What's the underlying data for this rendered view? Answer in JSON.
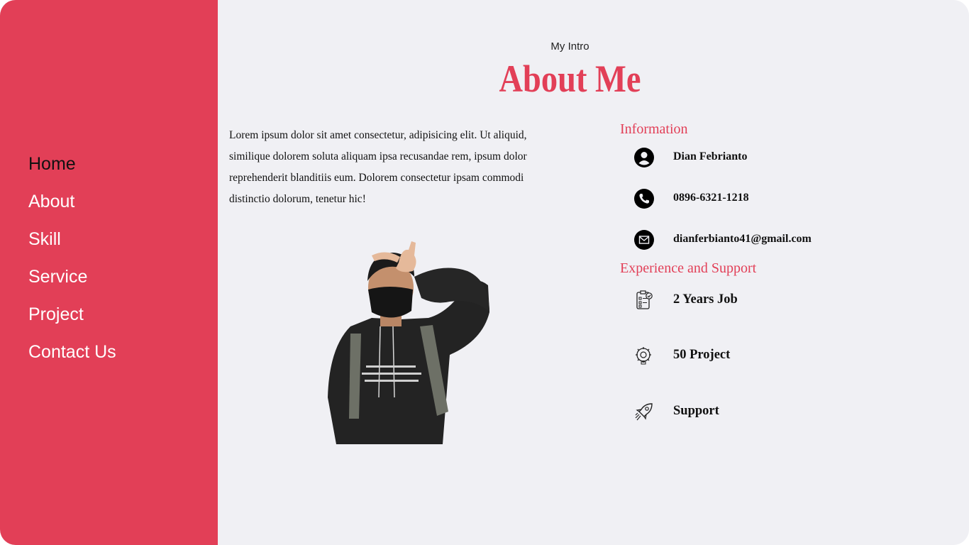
{
  "nav": {
    "items": [
      {
        "label": "Home"
      },
      {
        "label": "About"
      },
      {
        "label": "Skill"
      },
      {
        "label": "Service"
      },
      {
        "label": "Project"
      },
      {
        "label": "Contact Us"
      }
    ]
  },
  "header": {
    "subtitle": "My Intro",
    "title": "About Me"
  },
  "intro": {
    "text": "Lorem ipsum dolor sit amet consectetur, adipisicing elit. Ut aliquid, similique dolorem soluta aliquam ipsa recusandae rem, ipsum dolor reprehenderit blanditiis eum. Dolorem consectetur ipsam commodi distinctio dolorum, tenetur hic!"
  },
  "information": {
    "heading": "Information",
    "name": "Dian Febrianto",
    "phone": "0896-6321-1218",
    "email": "dianferbianto41@gmail.com"
  },
  "experience": {
    "heading": "Experience and Support",
    "items": [
      {
        "label": "2 Years Job",
        "icon": "clipboard-check-icon"
      },
      {
        "label": "50 Project",
        "icon": "gear-bulb-icon"
      },
      {
        "label": "Support",
        "icon": "rocket-icon"
      }
    ]
  },
  "colors": {
    "accent": "#e23f57",
    "background": "#f0f0f4"
  }
}
